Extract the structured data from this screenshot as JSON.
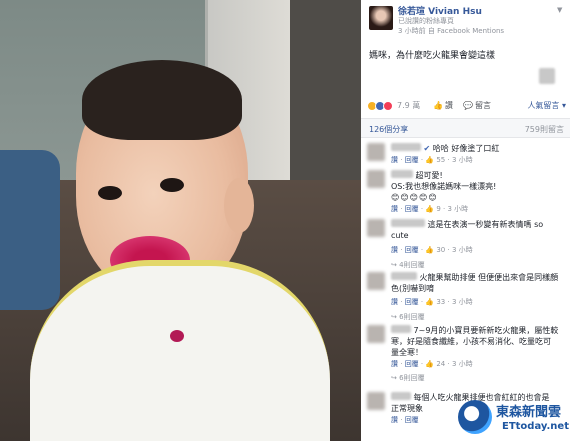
{
  "author": {
    "name": "徐若瑄 Vivian Hsu",
    "subtitle": "已說讚的粉絲專頁",
    "time": "3 小時前 自 Facebook Mentions"
  },
  "post": {
    "text": "媽咪，為什麼吃火龍果會變這樣"
  },
  "reactions": {
    "count": "7.9 萬",
    "like_label": "讚",
    "comment_label": "留言",
    "sort_label": "人氣留言 ▾"
  },
  "stats": {
    "shares": "126個分享",
    "comments": "759則留言"
  },
  "comments": [
    {
      "text": "哈哈 好像塗了口紅",
      "like": "讚",
      "reply": "回覆",
      "likes": "55",
      "time": "3 小時"
    },
    {
      "text": "超可愛!",
      "line2": "OS:我也想像諾媽咪一樣漂亮!",
      "emojis": "😊😊😊😊😊",
      "like": "讚",
      "reply": "回覆",
      "likes": "9",
      "time": "3 小時"
    },
    {
      "text": "這是在表演一秒變有新表情嗎 so",
      "line2": "cute",
      "like": "讚",
      "reply": "回覆",
      "likes": "30",
      "time": "3 小時",
      "replies": "4則回覆"
    },
    {
      "text": "火龍果幫助排便 但便便出來會是同樣顏",
      "line2": "色(別嚇到唷",
      "like": "讚",
      "reply": "回覆",
      "likes": "33",
      "time": "3 小時",
      "replies": "6則回覆"
    },
    {
      "text": "7~9月的小寶貝要新新吃火龍果，屬性較",
      "line2": "寒，好是隨食纖維，小孩不易消化、吃量吃可",
      "line3": "量全寒！",
      "like": "讚",
      "reply": "回覆",
      "likes": "24",
      "time": "3 小時",
      "replies": "6則回覆"
    },
    {
      "text": "每個人吃火龍果排便也會紅紅的也會是",
      "line2": "正常現象",
      "like": "讚",
      "reply": "回覆",
      "likes": "",
      "time": ""
    }
  ],
  "brand": {
    "name": "東森新聞雲",
    "domain": "ETtoday.net"
  },
  "colors": {
    "fb_blue": "#365899",
    "muted": "#90949c",
    "brand_blue": "#1e56a0"
  }
}
